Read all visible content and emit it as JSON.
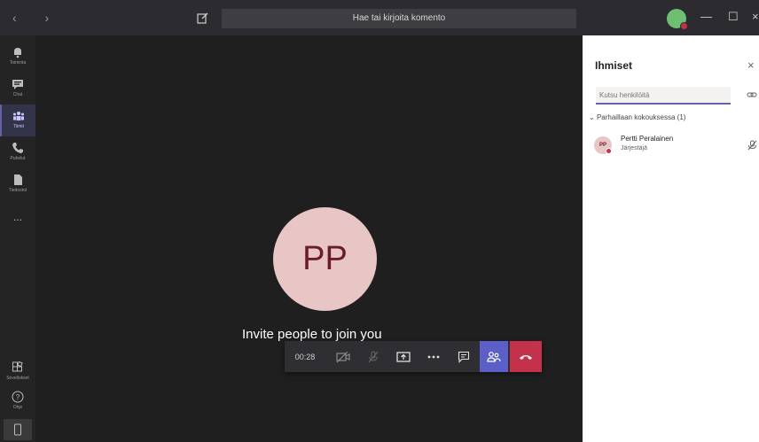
{
  "titlebar": {
    "nav": "‹ ›",
    "search_placeholder": "Hae tai kirjoita komento",
    "window_controls": {
      "minimize": "—",
      "maximize": "☐",
      "close": "×"
    }
  },
  "rail": {
    "items": [
      {
        "label": "Toiminta",
        "icon": "bell-icon"
      },
      {
        "label": "Chat",
        "icon": "chat-icon"
      },
      {
        "label": "Tiimit",
        "icon": "teams-icon",
        "active": true
      },
      {
        "label": "Puhelut",
        "icon": "phone-icon"
      },
      {
        "label": "Tiedostot",
        "icon": "files-icon"
      },
      {
        "label": "...",
        "icon": "more-icon"
      }
    ],
    "bottom": [
      {
        "label": "Sovellukset",
        "icon": "apps-icon"
      },
      {
        "label": "Ohje",
        "icon": "help-icon"
      }
    ]
  },
  "stage": {
    "avatar_initials": "PP",
    "invite_text": "Invite people to join you"
  },
  "callbar": {
    "timer": "00:28"
  },
  "panel": {
    "title": "Ihmiset",
    "close": "×",
    "invite_placeholder": "Kutsu henkilöitä",
    "section_label": "Parhaillaan kokouksessa (1)",
    "participants": [
      {
        "initials": "PP",
        "name": "Pertti Peralainen",
        "role": "Järjestäjä"
      }
    ]
  },
  "colors": {
    "accent": "#6264a7",
    "hangup": "#c4314b",
    "avatar_bg": "#e9c6c6"
  }
}
